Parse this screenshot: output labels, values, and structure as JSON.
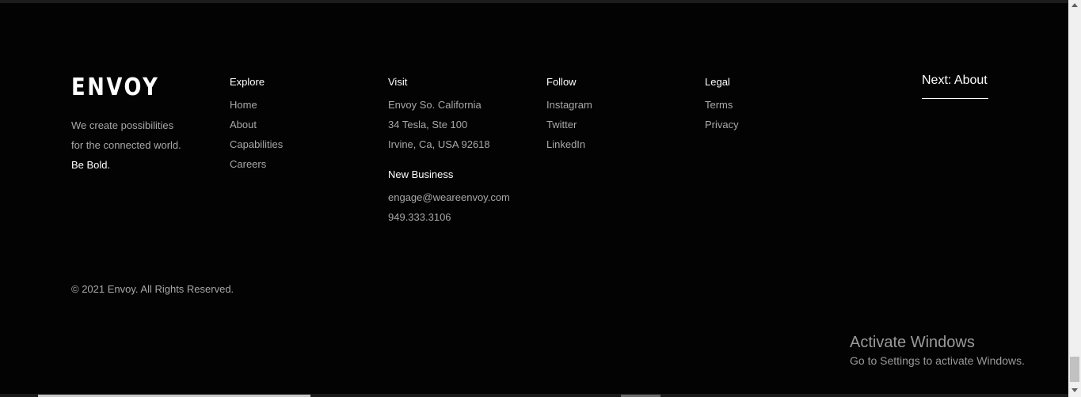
{
  "brand": {
    "logo": "ENVOY",
    "tagline_lines": [
      "We create possibilities",
      "for the connected world."
    ],
    "tagline_bold": "Be Bold."
  },
  "explore": {
    "heading": "Explore",
    "links": [
      "Home",
      "About",
      "Capabilities",
      "Careers"
    ]
  },
  "visit": {
    "heading": "Visit",
    "address": [
      "Envoy So. California",
      "34 Tesla, Ste 100",
      "Irvine, Ca, USA 92618"
    ]
  },
  "new_business": {
    "heading": "New Business",
    "email": "engage@weareenvoy.com",
    "phone": "949.333.3106"
  },
  "follow": {
    "heading": "Follow",
    "links": [
      "Instagram",
      "Twitter",
      "LinkedIn"
    ]
  },
  "legal": {
    "heading": "Legal",
    "links": [
      "Terms",
      "Privacy"
    ]
  },
  "next_link": "Next: About",
  "copyright": "© 2021 Envoy. All Rights Reserved.",
  "windows_watermark": {
    "title": "Activate Windows",
    "subtitle": "Go to Settings to activate Windows."
  },
  "colors": {
    "background": "#030303",
    "heading": "#ffffff",
    "link": "#a8a8a8"
  }
}
